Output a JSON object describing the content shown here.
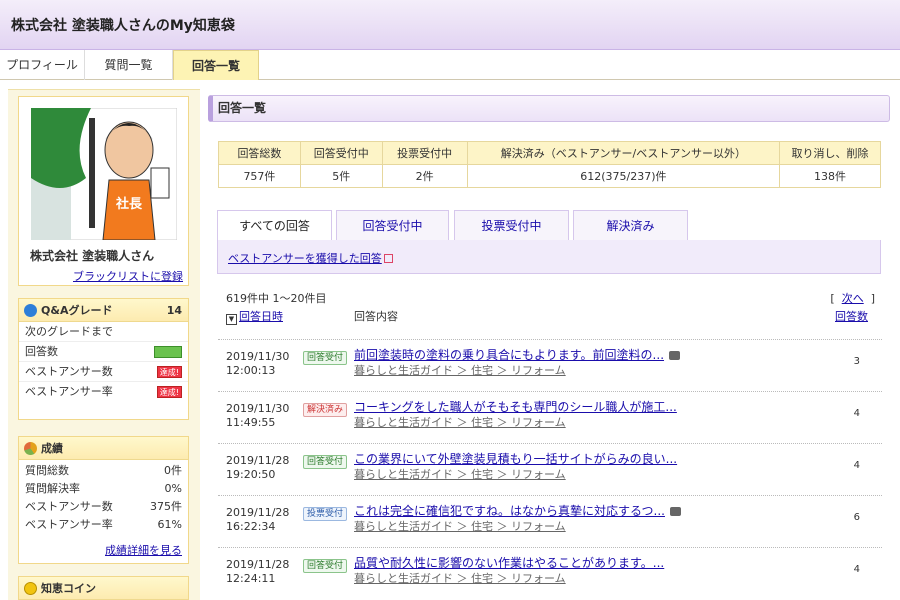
{
  "header": {
    "title": "株式会社 塗装職人さんのMy知恵袋"
  },
  "nav_tabs": [
    "プロフィール",
    "質問一覧",
    "回答一覧"
  ],
  "profile": {
    "name": "株式会社 塗装職人さん",
    "blacklist_link": "ブラックリストに登録",
    "avatar_text": "社長"
  },
  "grade": {
    "heading": "Q&Aグレード",
    "level": "14",
    "next_label": "次のグレードまで",
    "rows": [
      {
        "label": "回答数",
        "status": "complete"
      },
      {
        "label": "ベストアンサー数",
        "tag": "達成!"
      },
      {
        "label": "ベストアンサー率",
        "tag": "達成!"
      }
    ]
  },
  "performance": {
    "heading": "成績",
    "rows": [
      {
        "label": "質問総数",
        "value": "0件"
      },
      {
        "label": "質問解決率",
        "value": "0%"
      },
      {
        "label": "ベストアンサー数",
        "value": "375件"
      },
      {
        "label": "ベストアンサー率",
        "value": "61%"
      }
    ],
    "detail_link": "成績詳細を見る"
  },
  "coin": {
    "heading": "知恵コイン"
  },
  "main": {
    "heading": "回答一覧",
    "stats": {
      "headers": [
        "回答総数",
        "回答受付中",
        "投票受付中",
        "解決済み（ベストアンサー/ベストアンサー以外）",
        "取り消し、削除"
      ],
      "values": [
        "757件",
        "5件",
        "2件",
        "612(375/237)件",
        "138件"
      ]
    },
    "tabs": [
      "すべての回答",
      "回答受付中",
      "投票受付中",
      "解決済み"
    ],
    "best_answer_link": "ベストアンサーを獲得した回答",
    "count_text": "619件中 1〜20件目",
    "pager_open": "[",
    "pager_next": "次へ",
    "pager_close": "]",
    "sort_date": "回答日時",
    "col_content": "回答内容",
    "col_count": "回答数",
    "rows": [
      {
        "date": "2019/11/30",
        "time": "12:00:13",
        "badge": "回答受付",
        "title": "前回塗装時の塗料の乗り具合にもよります。前回塗料の...",
        "category": "暮らしと生活ガイド ＞ 住宅 ＞ リフォーム",
        "count": "3"
      },
      {
        "date": "2019/11/30",
        "time": "11:49:55",
        "badge": "解決済み",
        "title": "コーキングをした職人がそもそも専門のシール職人が施工...",
        "category": "暮らしと生活ガイド ＞ 住宅 ＞ リフォーム",
        "count": "4"
      },
      {
        "date": "2019/11/28",
        "time": "19:20:50",
        "badge": "回答受付",
        "title": "この業界にいて外壁塗装見積もり一括サイトがらみの良い...",
        "category": "暮らしと生活ガイド ＞ 住宅 ＞ リフォーム",
        "count": "4"
      },
      {
        "date": "2019/11/28",
        "time": "16:22:34",
        "badge": "投票受付",
        "title": "これは完全に確信犯ですね。はなから真摯に対応するつ...",
        "category": "暮らしと生活ガイド ＞ 住宅 ＞ リフォーム",
        "count": "6"
      },
      {
        "date": "2019/11/28",
        "time": "12:24:11",
        "badge": "回答受付",
        "title": "品質や耐久性に影響のない作業はやることがあります。...",
        "category": "暮らしと生活ガイド ＞ 住宅 ＞ リフォーム",
        "count": "4"
      }
    ]
  },
  "colors": {
    "accent_purple": "#e2d4f2",
    "accent_yellow": "#fdf3b4",
    "link": "#1a0dab"
  }
}
